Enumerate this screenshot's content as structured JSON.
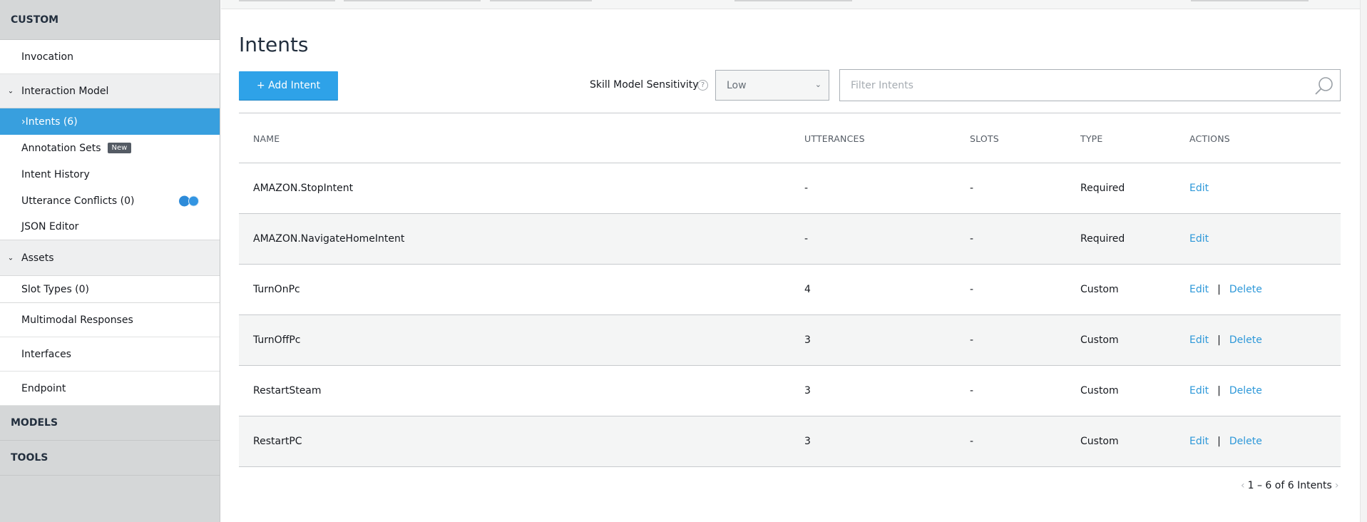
{
  "sidebar": {
    "custom_label": "CUSTOM",
    "invocation": "Invocation",
    "interaction_model": "Interaction Model",
    "intents": "Intents (6)",
    "annotation_sets": "Annotation Sets",
    "new_badge": "New",
    "intent_history": "Intent History",
    "utterance_conflicts": "Utterance Conflicts (0)",
    "json_editor": "JSON Editor",
    "assets": "Assets",
    "slot_types": "Slot Types (0)",
    "multimodal_responses": "Multimodal Responses",
    "interfaces": "Interfaces",
    "endpoint": "Endpoint",
    "models_label": "MODELS",
    "tools_label": "TOOLS"
  },
  "main": {
    "title": "Intents",
    "add_button": "+ Add Intent",
    "sensitivity_label": "Skill Model Sensitivity",
    "help_glyph": "?",
    "sensitivity_value": "Low",
    "filter_placeholder": "Filter Intents"
  },
  "table": {
    "headers": {
      "name": "NAME",
      "utterances": "UTTERANCES",
      "slots": "SLOTS",
      "type": "TYPE",
      "actions": "ACTIONS"
    },
    "edit_label": "Edit",
    "delete_label": "Delete",
    "separator": "|",
    "rows": [
      {
        "name": "AMAZON.StopIntent",
        "utterances": "-",
        "slots": "-",
        "type": "Required"
      },
      {
        "name": "AMAZON.NavigateHomeIntent",
        "utterances": "-",
        "slots": "-",
        "type": "Required"
      },
      {
        "name": "TurnOnPc",
        "utterances": "4",
        "slots": "-",
        "type": "Custom"
      },
      {
        "name": "TurnOffPc",
        "utterances": "3",
        "slots": "-",
        "type": "Custom"
      },
      {
        "name": "RestartSteam",
        "utterances": "3",
        "slots": "-",
        "type": "Custom"
      },
      {
        "name": "RestartPC",
        "utterances": "3",
        "slots": "-",
        "type": "Custom"
      }
    ]
  },
  "pagination": {
    "text": "1 – 6 of 6 Intents"
  },
  "colors": {
    "accent": "#2ea2e8",
    "link": "#2d98d9",
    "sidebar_active": "#389fde",
    "sidebar_bg": "#d5d7d8"
  }
}
